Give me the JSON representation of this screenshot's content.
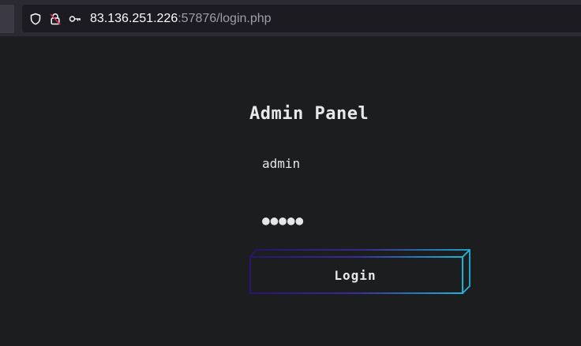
{
  "browser": {
    "url_host": "83.136.251.226",
    "url_rest": ":57876/login.php",
    "icons": [
      "shield-icon",
      "lock-slash-icon",
      "key-icon"
    ]
  },
  "login_form": {
    "title": "Admin Panel",
    "username_value": "admin",
    "password_value": "●●●●●",
    "submit_label": "Login"
  },
  "colors": {
    "page_bg": "#1c1d1f",
    "button_gradient_start": "#2a1470",
    "button_gradient_end": "#1fb2d8"
  }
}
